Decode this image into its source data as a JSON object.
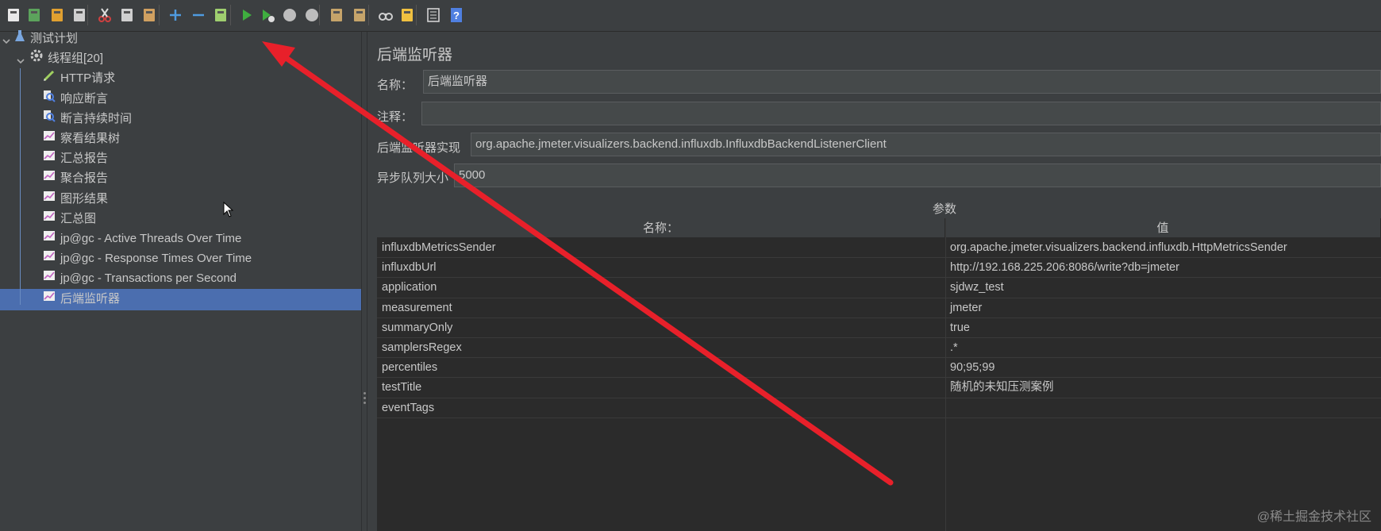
{
  "toolbar": {
    "buttons": [
      {
        "name": "new-icon",
        "color": "#e8e8e8"
      },
      {
        "name": "templates-icon",
        "color": "#5ca35c"
      },
      {
        "name": "open-icon",
        "color": "#e0a030"
      },
      {
        "name": "save-icon",
        "color": "#cfcfcf"
      },
      {
        "name": "cut-icon",
        "color": "#d04040"
      },
      {
        "name": "copy-icon",
        "color": "#cfcfcf"
      },
      {
        "name": "paste-icon",
        "color": "#d0a060"
      },
      {
        "name": "expand-icon",
        "color": "#4f9be0"
      },
      {
        "name": "collapse-icon",
        "color": "#4f9be0"
      },
      {
        "name": "toggle-icon",
        "color": "#9fcf6f"
      },
      {
        "name": "start-icon",
        "color": "#3fae3f"
      },
      {
        "name": "start-no-pauses-icon",
        "color": "#3fae3f"
      },
      {
        "name": "stop-icon",
        "color": "#bdbdbd"
      },
      {
        "name": "shutdown-icon",
        "color": "#bdbdbd"
      },
      {
        "name": "clear-icon",
        "color": "#c6a46a"
      },
      {
        "name": "clear-all-icon",
        "color": "#c6a46a"
      },
      {
        "name": "search-icon",
        "color": "#cfcfcf"
      },
      {
        "name": "reset-search-icon",
        "color": "#f0c040"
      },
      {
        "name": "function-helper-icon",
        "color": "#dcdcdc"
      },
      {
        "name": "help-icon",
        "color": "#4f7fe0"
      }
    ]
  },
  "tree": {
    "root": {
      "label": "测试计划"
    },
    "thread_group": {
      "label": "线程组[20]"
    },
    "children": [
      {
        "label": "HTTP请求",
        "icon": "pen-icon"
      },
      {
        "label": "响应断言",
        "icon": "assertion-icon"
      },
      {
        "label": "断言持续时间",
        "icon": "assertion-icon"
      },
      {
        "label": "察看结果树",
        "icon": "listener-icon"
      },
      {
        "label": "汇总报告",
        "icon": "listener-icon"
      },
      {
        "label": "聚合报告",
        "icon": "listener-icon"
      },
      {
        "label": "图形结果",
        "icon": "listener-icon"
      },
      {
        "label": "汇总图",
        "icon": "listener-icon"
      },
      {
        "label": "jp@gc - Active Threads Over Time",
        "icon": "listener-icon"
      },
      {
        "label": "jp@gc - Response Times Over Time",
        "icon": "listener-icon"
      },
      {
        "label": "jp@gc - Transactions per Second",
        "icon": "listener-icon"
      },
      {
        "label": "后端监听器",
        "icon": "listener-icon"
      }
    ]
  },
  "panel": {
    "title": "后端监听器",
    "name_label": "名称：",
    "name_value": "后端监听器",
    "comment_label": "注释：",
    "comment_value": "",
    "impl_label": "后端监听器实现",
    "impl_value": "org.apache.jmeter.visualizers.backend.influxdb.InfluxdbBackendListenerClient",
    "queue_label": "异步队列大小",
    "queue_value": "5000",
    "params_title": "参数"
  },
  "table": {
    "headers": [
      "名称：",
      "值"
    ],
    "rows": [
      [
        "influxdbMetricsSender",
        "org.apache.jmeter.visualizers.backend.influxdb.HttpMetricsSender"
      ],
      [
        "influxdbUrl",
        "http://192.168.225.206:8086/write?db=jmeter"
      ],
      [
        "application",
        "sjdwz_test"
      ],
      [
        "measurement",
        "jmeter"
      ],
      [
        "summaryOnly",
        "true"
      ],
      [
        "samplersRegex",
        ".*"
      ],
      [
        "percentiles",
        "90;95;99"
      ],
      [
        "testTitle",
        "随机的未知压测案例"
      ],
      [
        "eventTags",
        ""
      ]
    ]
  },
  "watermark": "@稀土掘金技术社区",
  "colors": {
    "selection": "#4b6eaf",
    "arrow": "#e8202a",
    "background": "#3c3f41"
  }
}
